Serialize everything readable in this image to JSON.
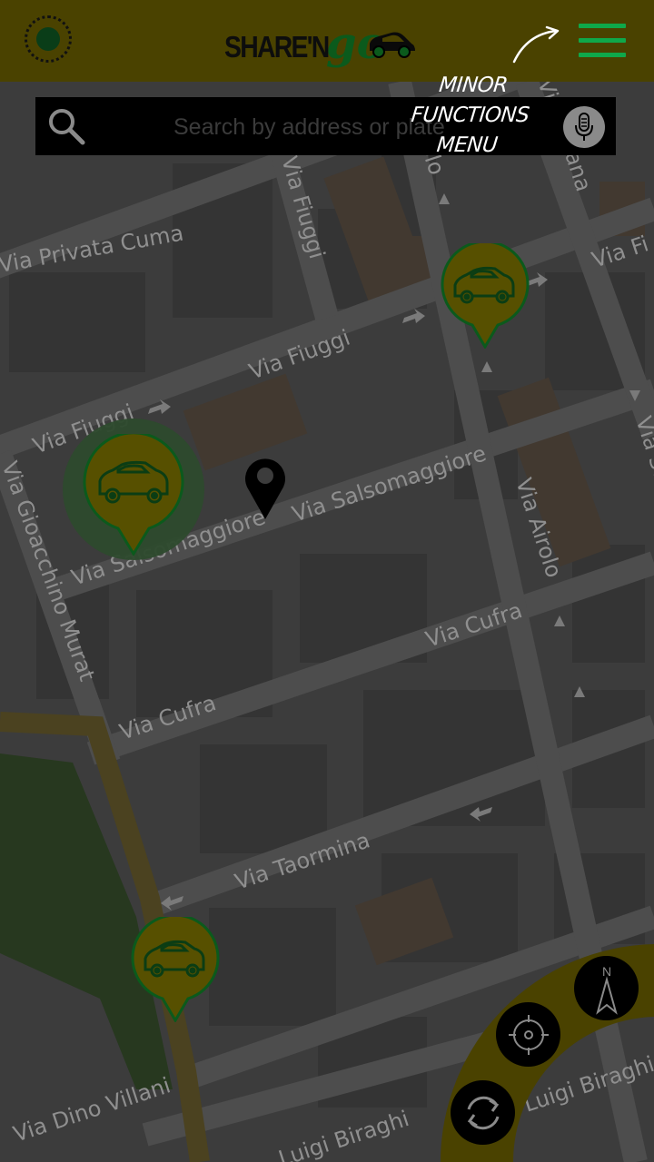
{
  "header": {
    "logo_part1": "SHARE'N",
    "logo_part2": "go"
  },
  "search": {
    "placeholder": "Search by address or plate"
  },
  "tutorial": {
    "line1": "MINOR",
    "line2": "FUNCTIONS",
    "line3": "MENU"
  },
  "map": {
    "streets": {
      "via_privata_cuma": "Via Privata Cuma",
      "via_fiuggi_upper": "Via Fiuggi",
      "via_fiuggi_lower": "Via Fiuggi",
      "via_fiuggi_vertical": "Via Fiuggi",
      "via_salsomaggiore_left": "Via Salsomaggiore",
      "via_salsomaggiore_right": "Via Salsomaggiore",
      "via_gioacchino_murat": "Via Gioacchino Murat",
      "via_airolo": "Via Airolo",
      "via_cufra_right": "Via Cufra",
      "via_cufra_left": "Via Cufra",
      "via_taormina": "Via Taormina",
      "via_dino_villani": "Via Dino Villani",
      "luigi_biraghi_bottom": "Luigi Biraghi",
      "luigi_biraghi_right": "Luigi Biraghi",
      "partial_olo": "olo",
      "partial_via": "Via",
      "partial_ana": "ana",
      "partial_via_fi": "Via Fi",
      "partial_via_sa": "Via Sa"
    }
  },
  "controls": {
    "compass_label": "N"
  },
  "colors": {
    "header_bg": "#4a4200",
    "brand_green": "#0fa84a",
    "marker_fill": "#575000",
    "marker_border": "#0b5a1c"
  }
}
